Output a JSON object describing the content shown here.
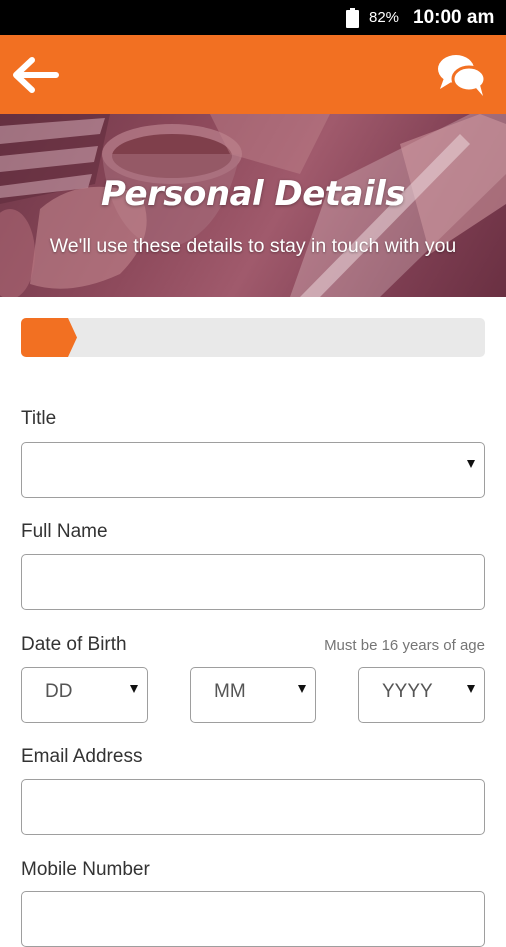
{
  "status_bar": {
    "battery": "82%",
    "time": "10:00 am"
  },
  "app_bar": {
    "back_icon": "arrow-left-icon",
    "chat_icon": "chat-bubbles-icon",
    "accent_color": "#f27022"
  },
  "hero": {
    "title": "Personal Details",
    "subtitle": "We'll use these details to stay in touch with you"
  },
  "progress": {
    "fraction": 0.12,
    "fill_color": "#f27022"
  },
  "form": {
    "title_label": "Title",
    "title_value": "",
    "full_name_label": "Full Name",
    "full_name_value": "",
    "dob_label": "Date of Birth",
    "dob_hint": "Must be 16 years of age",
    "dob_day": "DD",
    "dob_month": "MM",
    "dob_year": "YYYY",
    "email_label": "Email Address",
    "email_value": "",
    "mobile_label": "Mobile Number",
    "mobile_value": ""
  }
}
